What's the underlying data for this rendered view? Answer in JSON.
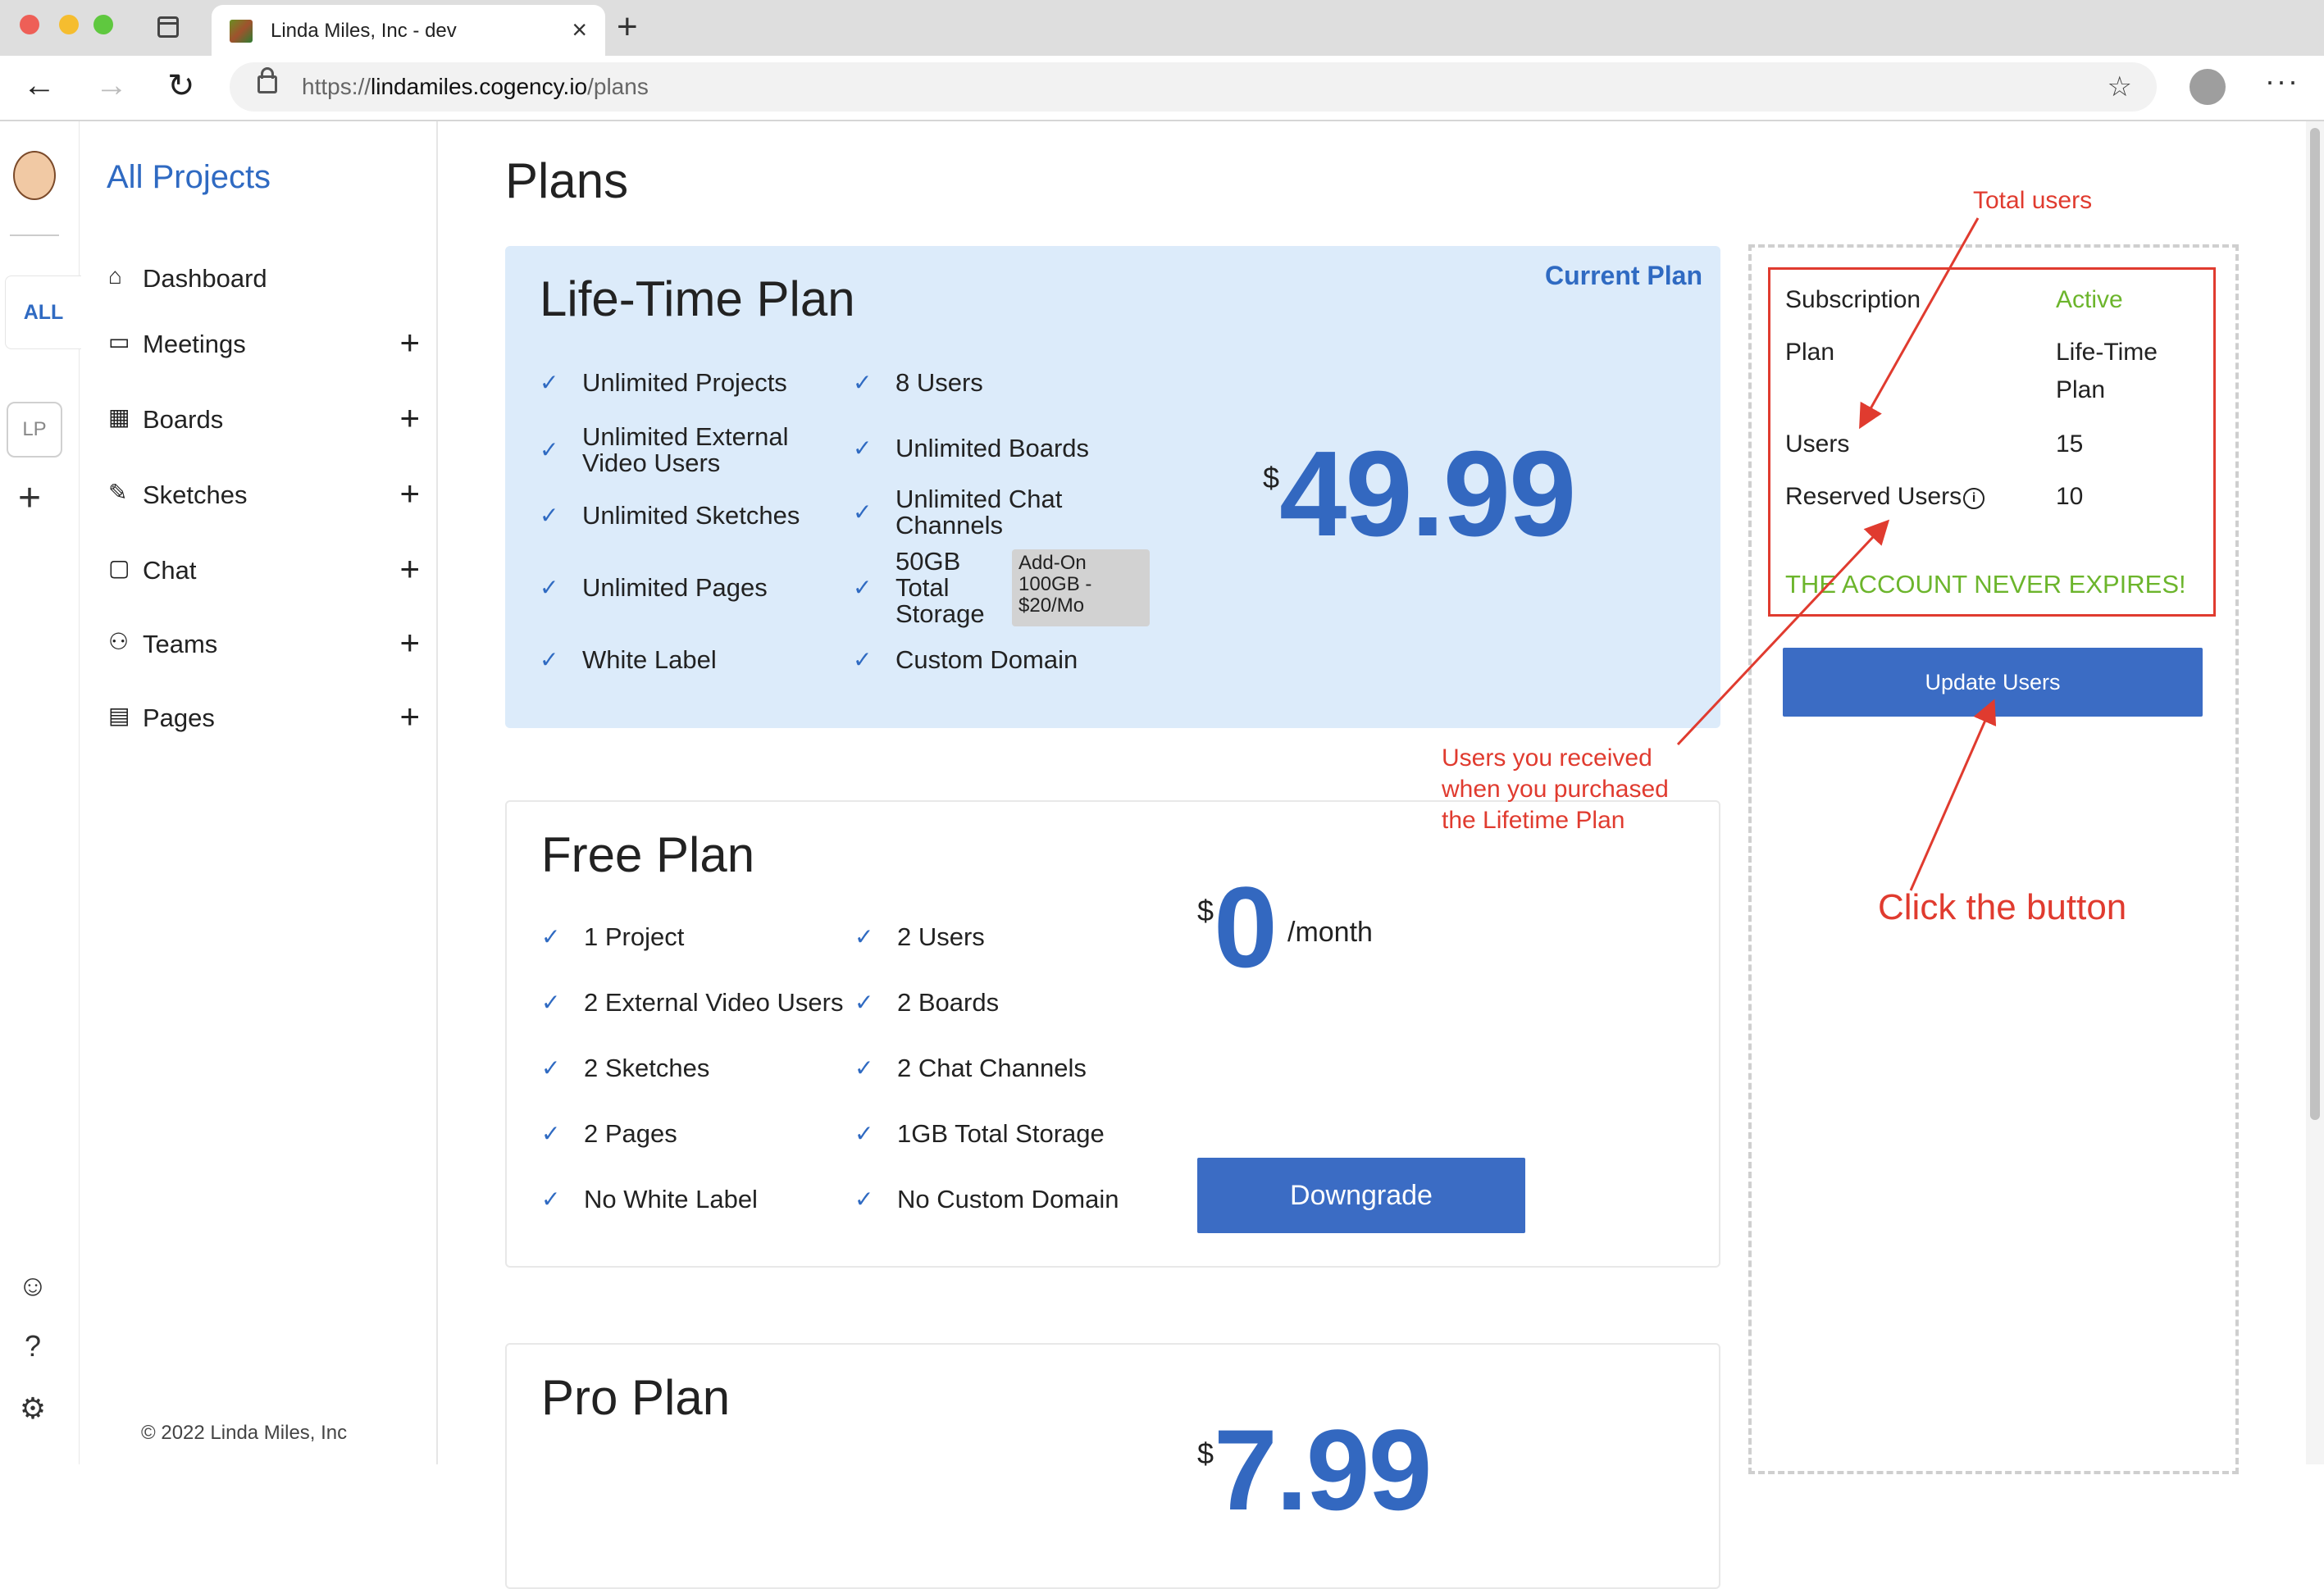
{
  "browser": {
    "tab_title": "Linda Miles, Inc - dev",
    "url_prefix": "https://",
    "url_host": "lindamiles.cogency.io",
    "url_path": "/plans",
    "traffic_colors": [
      "#ee5f57",
      "#f5bd2f",
      "#5fc83f"
    ]
  },
  "rail": {
    "all_label": "ALL",
    "project_badge": "LP"
  },
  "sidebar": {
    "heading": "All Projects",
    "items": [
      {
        "label": "Dashboard",
        "icon": "home-icon"
      },
      {
        "label": "Meetings",
        "icon": "video-icon"
      },
      {
        "label": "Boards",
        "icon": "board-icon"
      },
      {
        "label": "Sketches",
        "icon": "sketch-icon"
      },
      {
        "label": "Chat",
        "icon": "chat-icon"
      },
      {
        "label": "Teams",
        "icon": "teams-icon"
      },
      {
        "label": "Pages",
        "icon": "page-icon"
      }
    ],
    "footer": "© 2022 Linda Miles, Inc"
  },
  "page": {
    "title": "Plans"
  },
  "lifetime_plan": {
    "name": "Life-Time Plan",
    "badge": "Current Plan",
    "features_left": [
      "Unlimited Projects",
      "Unlimited External",
      "Video Users",
      "Unlimited Sketches",
      "Unlimited Pages",
      "White Label"
    ],
    "features_right": [
      "8 Users",
      "Unlimited Boards",
      "Unlimited Chat",
      "Channels",
      "50GB",
      "Total",
      "Storage",
      "Custom Domain"
    ],
    "addon": [
      "Add-On",
      "100GB -",
      "$20/Mo"
    ],
    "currency": "$",
    "price": "49.99"
  },
  "free_plan": {
    "name": "Free Plan",
    "features_left": [
      "1 Project",
      "2 External Video Users",
      "2 Sketches",
      "2 Pages",
      "No White Label"
    ],
    "features_right": [
      "2 Users",
      "2 Boards",
      "2 Chat Channels",
      "1GB Total Storage",
      "No Custom Domain"
    ],
    "currency": "$",
    "price": "0",
    "period": "/month",
    "button": "Downgrade"
  },
  "pro_plan": {
    "name": "Pro Plan",
    "currency": "$",
    "price": "7.99"
  },
  "subscription": {
    "rows": [
      {
        "key": "Subscription",
        "value": "Active"
      },
      {
        "key": "Plan",
        "value": "Life-Time"
      },
      {
        "key": "",
        "value": "Plan"
      },
      {
        "key": "Users",
        "value": "15"
      },
      {
        "key": "Reserved Users",
        "value": "10"
      }
    ],
    "info_glyph": "i",
    "status_color": "#6cb52c",
    "notice": "THE ACCOUNT NEVER EXPIRES!",
    "button": "Update Users"
  },
  "annotations": {
    "total_users": "Total users",
    "reserved_note": [
      "Users you received",
      "when you purchased",
      "the Lifetime Plan"
    ],
    "click_note": "Click the button",
    "color": "#e03b2f"
  }
}
